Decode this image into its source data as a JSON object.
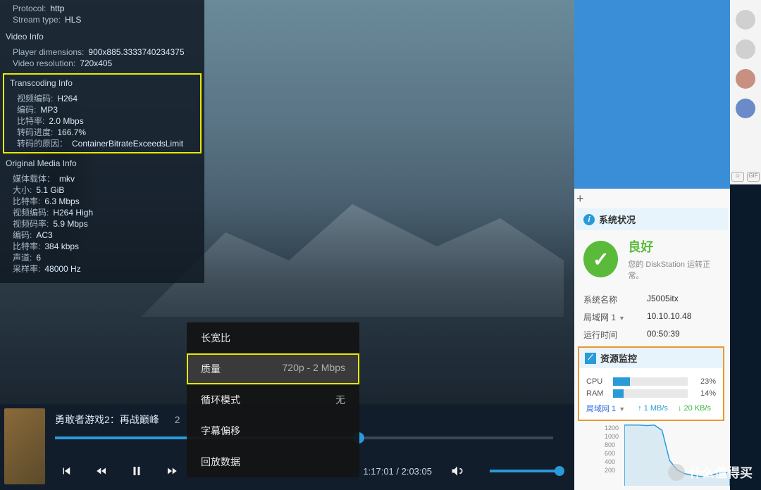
{
  "stream": {
    "protocol_label": "Protocol:",
    "protocol": "http",
    "type_label": "Stream type:",
    "type": "HLS"
  },
  "video_info": {
    "header": "Video Info",
    "dimensions_label": "Player dimensions:",
    "dimensions": "900x885.3333740234375",
    "resolution_label": "Video resolution:",
    "resolution": "720x405"
  },
  "transcoding": {
    "header": "Transcoding Info",
    "vcodec_label": "视频编码:",
    "vcodec": "H264",
    "acodec_label": "编码:",
    "acodec": "MP3",
    "bitrate_label": "比特率:",
    "bitrate": "2.0 Mbps",
    "progress_label": "转码进度:",
    "progress": "166.7%",
    "reason_label": "转码的原因：",
    "reason": "ContainerBitrateExceedsLimit"
  },
  "media": {
    "header": "Original Media Info",
    "container_label": "媒体载体：",
    "container": "mkv",
    "size_label": "大小:",
    "size": "5.1 GiB",
    "bitrate_label": "比特率:",
    "bitrate": "6.3 Mbps",
    "vcodec_label": "视频编码:",
    "vcodec": "H264 High",
    "vbitrate_label": "视频码率:",
    "vbitrate": "5.9 Mbps",
    "acodec_label": "编码:",
    "acodec": "AC3",
    "abitrate_label": "比特率:",
    "abitrate": "384 kbps",
    "channels_label": "声道:",
    "channels": "6",
    "samplerate_label": "采样率:",
    "samplerate": "48000 Hz"
  },
  "player": {
    "title": "勇敢者游戏2：再战巅峰",
    "year_partial": "2",
    "time": "1:17:01 / 2:03:05"
  },
  "menu": {
    "aspect": "长宽比",
    "quality": "质量",
    "quality_value": "720p - 2 Mbps",
    "loop": "循环模式",
    "loop_value": "无",
    "subtitle": "字幕偏移",
    "playback": "回放数据"
  },
  "system_status": {
    "header": "系统状况",
    "status": "良好",
    "subtitle": "您的 DiskStation 运转正常。",
    "name_label": "系统名称",
    "name": "J5005itx",
    "lan_label": "局域网 1",
    "lan": "10.10.10.48",
    "uptime_label": "运行时间",
    "uptime": "00:50:39"
  },
  "monitor": {
    "header": "资源监控",
    "cpu_label": "CPU",
    "cpu_pct": "23%",
    "cpu_width": 23,
    "ram_label": "RAM",
    "ram_pct": "14%",
    "ram_width": 14,
    "net_label": "局域网 1",
    "up": "1 MB/s",
    "down": "20 KB/s"
  },
  "chart_data": {
    "type": "line",
    "title": "",
    "ylabel": "",
    "xlabel": "",
    "ylim": [
      0,
      1200
    ],
    "y_ticks": [
      200,
      400,
      600,
      800,
      1000,
      1200
    ],
    "x": [
      0,
      1,
      2,
      3,
      4,
      5,
      6,
      7,
      8,
      9,
      10,
      11,
      12,
      13,
      14
    ],
    "values": [
      1150,
      1150,
      1150,
      1140,
      1150,
      1050,
      480,
      300,
      230,
      200,
      180,
      170,
      220,
      260,
      240
    ]
  },
  "watermark": "什么值得买"
}
